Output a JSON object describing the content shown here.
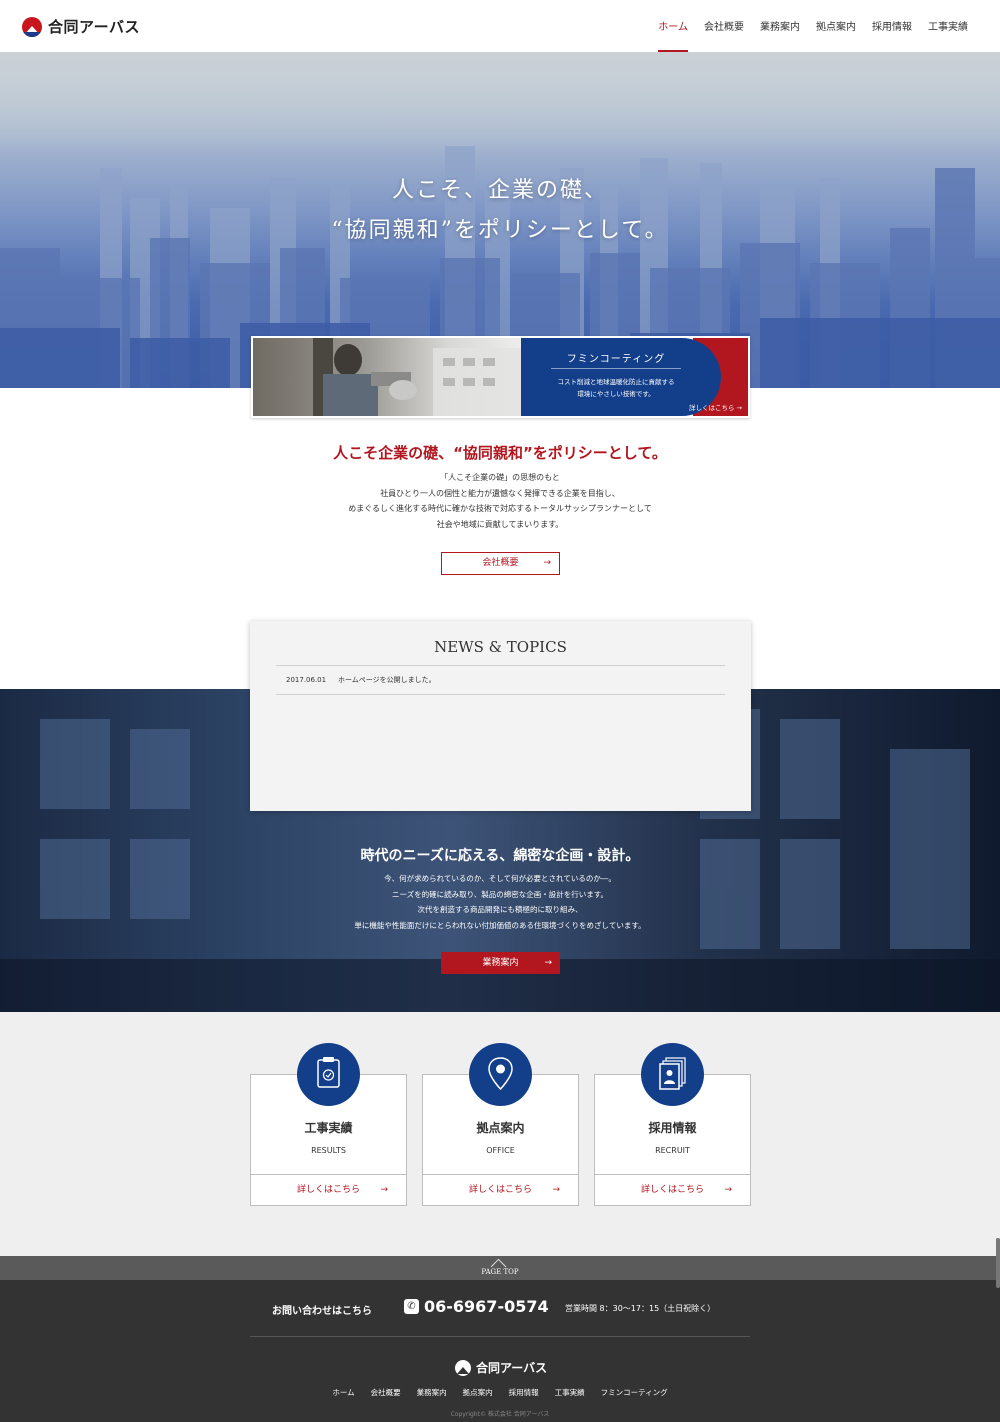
{
  "header": {
    "logo_text": "合同アーバス",
    "nav": [
      {
        "label": "ホーム",
        "active": true
      },
      {
        "label": "会社概要",
        "active": false
      },
      {
        "label": "業務案内",
        "active": false
      },
      {
        "label": "拠点案内",
        "active": false
      },
      {
        "label": "採用情報",
        "active": false
      },
      {
        "label": "工事実績",
        "active": false
      }
    ]
  },
  "hero": {
    "line1": "人こそ、企業の礎、",
    "line2": "“協同親和”をポリシーとして。"
  },
  "banner": {
    "title": "フミンコーティング",
    "desc_line1": "コスト削減と地球温暖化防止に貢献する",
    "desc_line2": "環境にやさしい技術です。",
    "link": "詳しくはこちら →"
  },
  "intro": {
    "title": "人こそ企業の礎、“協同親和”をポリシーとして。",
    "lines": [
      "「人こそ企業の礎」の思想のもと",
      "社員ひとり一人の個性と能力が遺憾なく発揮できる企業を目指し、",
      "めまぐるしく進化する時代に確かな技術で対応するトータルサッシプランナーとして",
      "社会や地域に貢献してまいります。"
    ],
    "button": "会社概要",
    "button_arrow": "→"
  },
  "news": {
    "title": "NEWS & TOPICS",
    "items": [
      {
        "date": "2017.06.01",
        "text": "ホームページを公開しました。"
      }
    ]
  },
  "business": {
    "title": "時代のニーズに応える、綿密な企画・設計。",
    "lines": [
      "今、何が求められているのか、そして何が必要とされているのか―。",
      "ニーズを的確に読み取り、製品の綿密な企画・設計を行います。",
      "次代を創造する商品開発にも積極的に取り組み、",
      "単に機能や性能面だけにとらわれない付加価値のある住環境づくりをめざしています。"
    ],
    "button": "業務案内",
    "button_arrow": "→"
  },
  "cards": [
    {
      "title": "工事実績",
      "sub": "RESULTS",
      "link": "詳しくはこちら",
      "arrow": "→",
      "icon": "clipboard-icon"
    },
    {
      "title": "拠点案内",
      "sub": "OFFICE",
      "link": "詳しくはこちら",
      "arrow": "→",
      "icon": "map-pin-icon"
    },
    {
      "title": "採用情報",
      "sub": "RECRUIT",
      "link": "詳しくはこちら",
      "arrow": "→",
      "icon": "profile-cards-icon"
    }
  ],
  "footer": {
    "page_top": "PAGE TOP",
    "contact_label": "お問い合わせはこちら",
    "phone": "06-6967-0574",
    "hours": "営業時間 8：30〜17：15（土日祝除く）",
    "logo_text": "合同アーバス",
    "nav": [
      "ホーム",
      "会社概要",
      "業務案内",
      "拠点案内",
      "採用情報",
      "工事実績",
      "フミンコーティング"
    ],
    "copyright": "Copyright© 株式会社 合同アーバス"
  },
  "colors": {
    "accent_red": "#b2161e",
    "brand_blue": "#133f8a",
    "footer_bg": "#333333"
  }
}
